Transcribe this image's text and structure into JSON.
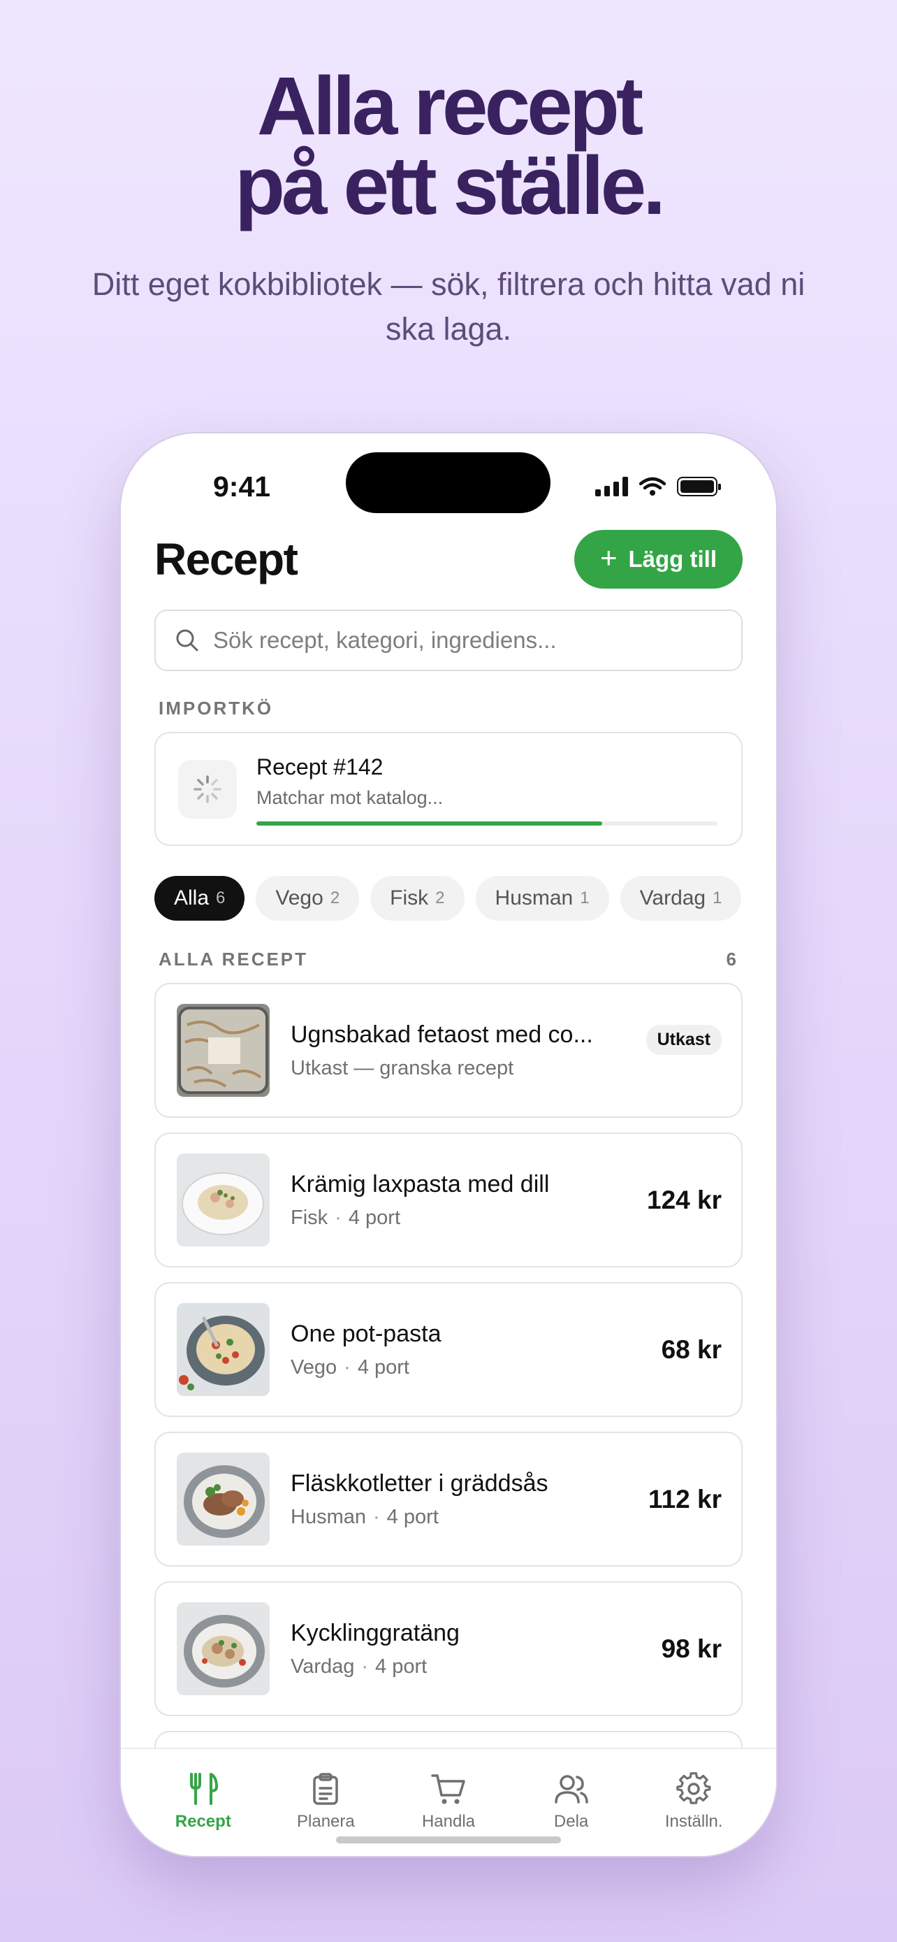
{
  "hero": {
    "title_line1": "Alla recept",
    "title_line2": "på ett ställe.",
    "subtitle": "Ditt eget kokbibliotek — sök, filtrera och hitta vad ni ska laga."
  },
  "status_bar": {
    "time": "9:41"
  },
  "header": {
    "title": "Recept",
    "add_button": "Lägg till"
  },
  "search": {
    "placeholder": "Sök recept, kategori, ingrediens..."
  },
  "import_queue": {
    "label": "IMPORTKÖ",
    "title": "Recept #142",
    "status": "Matchar mot katalog...",
    "progress": 0.75
  },
  "filters": [
    {
      "label": "Alla",
      "count": "6",
      "active": true
    },
    {
      "label": "Vego",
      "count": "2"
    },
    {
      "label": "Fisk",
      "count": "2"
    },
    {
      "label": "Husman",
      "count": "1"
    },
    {
      "label": "Vardag",
      "count": "1"
    }
  ],
  "list": {
    "label": "ALLA RECEPT",
    "count": "6",
    "items": [
      {
        "title": "Ugnsbakad fetaost med co...",
        "meta": "Utkast — granska recept",
        "badge": "Utkast"
      },
      {
        "title": "Krämig laxpasta med dill",
        "category": "Fisk",
        "portions": "4 port",
        "price": "124 kr"
      },
      {
        "title": "One pot-pasta",
        "category": "Vego",
        "portions": "4 port",
        "price": "68 kr"
      },
      {
        "title": "Fläskkotletter i gräddsås",
        "category": "Husman",
        "portions": "4 port",
        "price": "112 kr"
      },
      {
        "title": "Kycklinggratäng",
        "category": "Vardag",
        "portions": "4 port",
        "price": "98 kr"
      }
    ]
  },
  "tabs": [
    {
      "label": "Recept",
      "icon": "fork-knife-icon",
      "active": true
    },
    {
      "label": "Planera",
      "icon": "clipboard-icon"
    },
    {
      "label": "Handla",
      "icon": "cart-icon"
    },
    {
      "label": "Dela",
      "icon": "people-icon"
    },
    {
      "label": "Inställn.",
      "icon": "gear-icon"
    }
  ],
  "colors": {
    "accent": "#34a547",
    "hero_title": "#3a2260",
    "background": "#e6d9fb"
  }
}
